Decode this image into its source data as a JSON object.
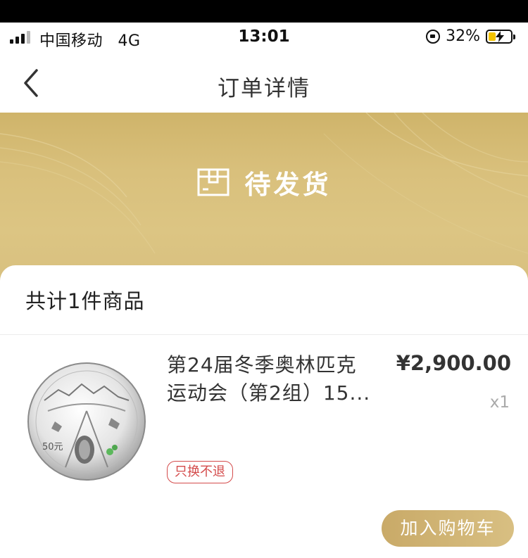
{
  "status_bar": {
    "carrier": "中国移动",
    "network": "4G",
    "time": "13:01",
    "battery_percent": "32%",
    "battery_level": 0.32
  },
  "nav": {
    "title": "订单详情",
    "back_icon": "chevron-left-icon"
  },
  "banner": {
    "status_icon": "package-box-icon",
    "status_text": "待发货",
    "color": "#d5bc79"
  },
  "order": {
    "summary": "共计1件商品",
    "item": {
      "name_line1": "第24届冬季奥林匹克",
      "name_line2": "运动会（第2组）15...",
      "price": "¥2,900.00",
      "quantity": "x1",
      "tag": "只换不退",
      "coin_denomination": "50元"
    },
    "add_to_cart": "加入购物车"
  },
  "colors": {
    "gold": "#cfb46a",
    "button_gold": "#c9aa68",
    "tag_red": "#d44b4b"
  }
}
